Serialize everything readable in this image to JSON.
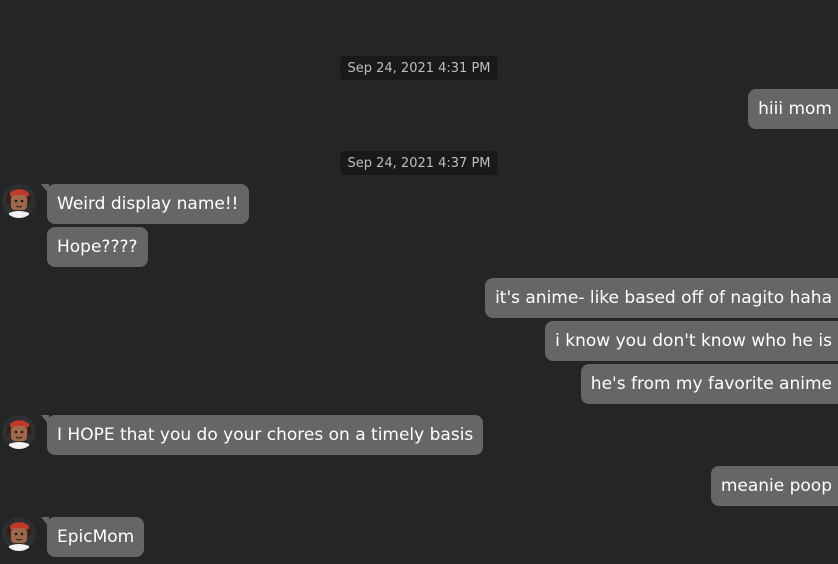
{
  "colors": {
    "background": "#232527",
    "bubble": "#656668",
    "timestamp_bg": "#18191b",
    "timestamp_text": "#bdbebe",
    "text": "#ffffff"
  },
  "timestamps": [
    "Sep 24, 2021 4:31 PM",
    "Sep 24, 2021 4:37 PM"
  ],
  "messages": [
    {
      "sender": "me",
      "text": "hiii mom"
    },
    {
      "sender": "other",
      "text": "Weird display name!!"
    },
    {
      "sender": "other",
      "text": "Hope????"
    },
    {
      "sender": "me",
      "text": "it's anime- like based off of nagito haha"
    },
    {
      "sender": "me",
      "text": "i know you don't know who he is"
    },
    {
      "sender": "me",
      "text": "he's from my favorite anime"
    },
    {
      "sender": "other",
      "text": "I HOPE that you do your chores on a timely basis"
    },
    {
      "sender": "me",
      "text": "meanie poop"
    },
    {
      "sender": "other",
      "text": "EpicMom"
    }
  ],
  "avatar_icon": "user-avatar-icon"
}
